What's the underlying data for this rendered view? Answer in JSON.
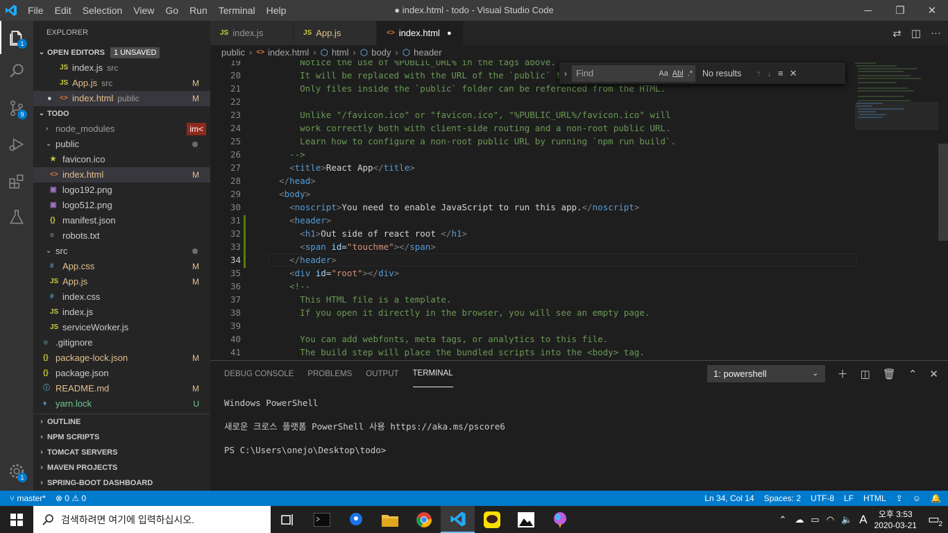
{
  "window": {
    "title": "● index.html - todo - Visual Studio Code",
    "menu": [
      "File",
      "Edit",
      "Selection",
      "View",
      "Go",
      "Run",
      "Terminal",
      "Help"
    ]
  },
  "activity": {
    "explorer_badge": "1",
    "scm_badge": "9",
    "settings_badge": "1"
  },
  "sidebar": {
    "title": "EXPLORER",
    "open_editors": {
      "label": "OPEN EDITORS",
      "badge": "1 UNSAVED",
      "items": [
        {
          "icon": "JS",
          "name": "index.js",
          "desc": "src",
          "status": ""
        },
        {
          "icon": "JS",
          "name": "App.js",
          "desc": "src",
          "status": "M"
        },
        {
          "icon": "<>",
          "name": "index.html",
          "desc": "public",
          "status": "M"
        }
      ]
    },
    "todo": {
      "label": "TODO",
      "hover_hint": "im<",
      "items": [
        {
          "name": "node_modules",
          "status": ""
        },
        {
          "name": "public",
          "status": ""
        },
        {
          "icon": "★",
          "name": "favicon.ico",
          "status": ""
        },
        {
          "icon": "<>",
          "name": "index.html",
          "status": "M"
        },
        {
          "icon": "▣",
          "name": "logo192.png",
          "status": ""
        },
        {
          "icon": "▣",
          "name": "logo512.png",
          "status": ""
        },
        {
          "icon": "{}",
          "name": "manifest.json",
          "status": ""
        },
        {
          "icon": "≡",
          "name": "robots.txt",
          "status": ""
        },
        {
          "name": "src",
          "status": ""
        },
        {
          "icon": "#",
          "name": "App.css",
          "status": "M"
        },
        {
          "icon": "JS",
          "name": "App.js",
          "status": "M"
        },
        {
          "icon": "#",
          "name": "index.css",
          "status": ""
        },
        {
          "icon": "JS",
          "name": "index.js",
          "status": ""
        },
        {
          "icon": "JS",
          "name": "serviceWorker.js",
          "status": ""
        },
        {
          "icon": "◆",
          "name": ".gitignore",
          "status": ""
        },
        {
          "icon": "{}",
          "name": "package-lock.json",
          "status": "M"
        },
        {
          "icon": "{}",
          "name": "package.json",
          "status": ""
        },
        {
          "icon": "ⓘ",
          "name": "README.md",
          "status": "M"
        },
        {
          "icon": "♦",
          "name": "yarn.lock",
          "status": "U"
        }
      ]
    },
    "sections": [
      "OUTLINE",
      "NPM SCRIPTS",
      "TOMCAT SERVERS",
      "MAVEN PROJECTS",
      "SPRING-BOOT DASHBOARD"
    ]
  },
  "tabs": [
    {
      "icon": "JS",
      "label": "index.js"
    },
    {
      "icon": "JS",
      "label": "App.js"
    },
    {
      "icon": "<>",
      "label": "index.html",
      "dirty": "●"
    }
  ],
  "breadcrumb": [
    "public",
    "index.html",
    "html",
    "body",
    "header"
  ],
  "find": {
    "placeholder": "Find",
    "options": [
      "Aa",
      "Abl",
      ".*"
    ],
    "result": "No results"
  },
  "editor": {
    "line_numbers": [
      "19",
      "20",
      "21",
      "22",
      "23",
      "24",
      "25",
      "26",
      "27",
      "28",
      "29",
      "30",
      "31",
      "32",
      "33",
      "34",
      "35",
      "36",
      "37",
      "38",
      "39",
      "40",
      "41"
    ],
    "lines": [
      [
        {
          "c": "cmt",
          "t": "      Notice the use of %PUBLIC_URL% in the tags above."
        }
      ],
      [
        {
          "c": "cmt",
          "t": "      It will be replaced with the URL of the `public` folder during the build."
        }
      ],
      [
        {
          "c": "cmt",
          "t": "      Only files inside the `public` folder can be referenced from the HTML."
        }
      ],
      [
        {
          "c": "cmt",
          "t": ""
        }
      ],
      [
        {
          "c": "cmt",
          "t": "      Unlike \"/favicon.ico\" or \"favicon.ico\", \"%PUBLIC_URL%/favicon.ico\" will"
        }
      ],
      [
        {
          "c": "cmt",
          "t": "      work correctly both with client-side routing and a non-root public URL."
        }
      ],
      [
        {
          "c": "cmt",
          "t": "      Learn how to configure a non-root public URL by running `npm run build`."
        }
      ],
      [
        {
          "c": "cmt",
          "t": "    -->"
        }
      ],
      [
        {
          "c": "tx",
          "t": "    "
        },
        {
          "c": "br",
          "t": "<"
        },
        {
          "c": "tag",
          "t": "title"
        },
        {
          "c": "br",
          "t": ">"
        },
        {
          "c": "tx",
          "t": "React App"
        },
        {
          "c": "br",
          "t": "</"
        },
        {
          "c": "tag",
          "t": "title"
        },
        {
          "c": "br",
          "t": ">"
        }
      ],
      [
        {
          "c": "tx",
          "t": "  "
        },
        {
          "c": "br",
          "t": "</"
        },
        {
          "c": "tag",
          "t": "head"
        },
        {
          "c": "br",
          "t": ">"
        }
      ],
      [
        {
          "c": "tx",
          "t": "  "
        },
        {
          "c": "br",
          "t": "<"
        },
        {
          "c": "tag",
          "t": "body"
        },
        {
          "c": "br",
          "t": ">"
        }
      ],
      [
        {
          "c": "tx",
          "t": "    "
        },
        {
          "c": "br",
          "t": "<"
        },
        {
          "c": "tag",
          "t": "noscript"
        },
        {
          "c": "br",
          "t": ">"
        },
        {
          "c": "tx",
          "t": "You need to enable JavaScript to run this app."
        },
        {
          "c": "br",
          "t": "</"
        },
        {
          "c": "tag",
          "t": "noscript"
        },
        {
          "c": "br",
          "t": ">"
        }
      ],
      [
        {
          "c": "tx",
          "t": "    "
        },
        {
          "c": "br",
          "t": "<"
        },
        {
          "c": "tag",
          "t": "header"
        },
        {
          "c": "br",
          "t": ">"
        }
      ],
      [
        {
          "c": "tx",
          "t": "      "
        },
        {
          "c": "br",
          "t": "<"
        },
        {
          "c": "tag",
          "t": "h1"
        },
        {
          "c": "br",
          "t": ">"
        },
        {
          "c": "tx",
          "t": "Out side of react root "
        },
        {
          "c": "br",
          "t": "</"
        },
        {
          "c": "tag",
          "t": "h1"
        },
        {
          "c": "br",
          "t": ">"
        }
      ],
      [
        {
          "c": "tx",
          "t": "      "
        },
        {
          "c": "br",
          "t": "<"
        },
        {
          "c": "tag",
          "t": "span"
        },
        {
          "c": "tx",
          "t": " "
        },
        {
          "c": "at",
          "t": "id"
        },
        {
          "c": "tx",
          "t": "="
        },
        {
          "c": "str",
          "t": "\"touchme\""
        },
        {
          "c": "br",
          "t": "></"
        },
        {
          "c": "tag",
          "t": "span"
        },
        {
          "c": "br",
          "t": ">"
        }
      ],
      [
        {
          "c": "tx",
          "t": "    "
        },
        {
          "c": "br",
          "t": "</"
        },
        {
          "c": "tag",
          "t": "header"
        },
        {
          "c": "br",
          "t": ">"
        }
      ],
      [
        {
          "c": "tx",
          "t": "    "
        },
        {
          "c": "br",
          "t": "<"
        },
        {
          "c": "tag",
          "t": "div"
        },
        {
          "c": "tx",
          "t": " "
        },
        {
          "c": "at",
          "t": "id"
        },
        {
          "c": "tx",
          "t": "="
        },
        {
          "c": "str",
          "t": "\"root\""
        },
        {
          "c": "br",
          "t": "></"
        },
        {
          "c": "tag",
          "t": "div"
        },
        {
          "c": "br",
          "t": ">"
        }
      ],
      [
        {
          "c": "tx",
          "t": "    "
        },
        {
          "c": "cmt",
          "t": "<!--"
        }
      ],
      [
        {
          "c": "cmt",
          "t": "      This HTML file is a template."
        }
      ],
      [
        {
          "c": "cmt",
          "t": "      If you open it directly in the browser, you will see an empty page."
        }
      ],
      [
        {
          "c": "cmt",
          "t": ""
        }
      ],
      [
        {
          "c": "cmt",
          "t": "      You can add webfonts, meta tags, or analytics to this file."
        }
      ],
      [
        {
          "c": "cmt",
          "t": "      The build step will place the bundled scripts into the <body> tag."
        }
      ]
    ],
    "current_line": 15
  },
  "panel": {
    "tabs": [
      "DEBUG CONSOLE",
      "PROBLEMS",
      "OUTPUT",
      "TERMINAL"
    ],
    "active_tab": 3,
    "terminal_select": "1: powershell",
    "terminal_lines": [
      "Windows PowerShell",
      "새로운 크로스 플랫폼 PowerShell 사용 https://aka.ms/pscore6",
      "PS C:\\Users\\onejo\\Desktop\\todo>"
    ]
  },
  "status": {
    "branch": "master*",
    "problems": "0",
    "warnings": "0",
    "position": "Ln 34, Col 14",
    "spaces": "Spaces: 2",
    "encoding": "UTF-8",
    "eol": "LF",
    "language": "HTML"
  },
  "taskbar": {
    "search_placeholder": "검색하려면 여기에 입력하십시오.",
    "time": "오후 3:53",
    "date": "2020-03-21",
    "ime": "A",
    "notifications": "2"
  },
  "colors": {
    "accent": "#007acc",
    "modified": "#e2c08d",
    "untracked": "#73c991"
  }
}
